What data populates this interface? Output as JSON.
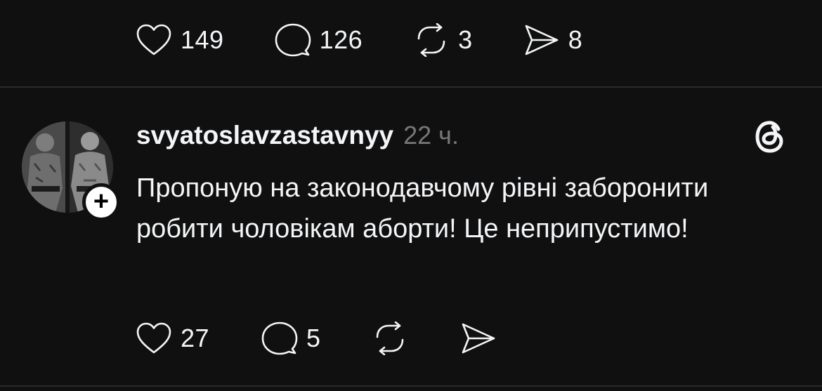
{
  "top_post_actions": {
    "likes": "149",
    "replies": "126",
    "reposts": "3",
    "shares": "8"
  },
  "post": {
    "username": "svyatoslavzastavnyy",
    "timestamp": "22 ч.",
    "text": "Пропоную на законодавчому рівні заборонити робити чоловікам аборти! Це неприпустимо!",
    "follow_label": "+",
    "actions": {
      "likes": "27",
      "replies": "5"
    }
  },
  "icons": {
    "like": "heart-icon",
    "reply": "comment-icon",
    "repost": "repost-icon",
    "share": "send-icon",
    "app": "threads-logo-icon",
    "follow": "plus-icon"
  },
  "colors": {
    "background": "#101010",
    "text": "#f3f5f7",
    "muted": "#777777",
    "divider": "#2a2a2a"
  }
}
